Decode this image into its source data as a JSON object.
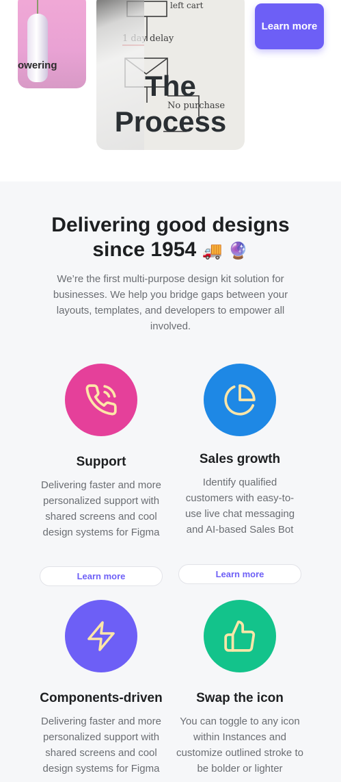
{
  "hero": {
    "card_flower_label": "owering",
    "card_process_title": "The Process",
    "whiteboard_texts": [
      "left cart",
      "1 day delay",
      "No purchase"
    ],
    "cta_label": "Learn more"
  },
  "features": {
    "heading_line1": "Delivering good designs",
    "heading_line2": "since 1954",
    "heading_emojis": "🚚 🔮",
    "intro": "We’re the first multi-purpose design kit solution for businesses. We help you bridge gaps between your layouts, templates, and developers to empower all involved.",
    "items": [
      {
        "title": "Support",
        "icon": "phone-ringing-icon",
        "color": "#e5409a",
        "desc": "Delivering faster and more personalized support with shared screens and cool design systems for Figma",
        "button": "Learn more"
      },
      {
        "title": "Sales growth",
        "icon": "pie-chart-icon",
        "color": "#1e88e5",
        "desc": "Identify qualified customers with easy-to-use live chat messaging and AI-based Sales Bot",
        "button": "Learn more"
      },
      {
        "title": "Components-driven",
        "icon": "lightning-icon",
        "color": "#6d5ff6",
        "desc": "Delivering faster and more personalized support with shared screens and cool design systems for Figma"
      },
      {
        "title": "Swap the icon",
        "icon": "thumbs-up-icon",
        "color": "#13c38b",
        "desc": "You can toggle to any icon within Instances and customize outlined stroke to be bolder or lighter"
      }
    ]
  }
}
